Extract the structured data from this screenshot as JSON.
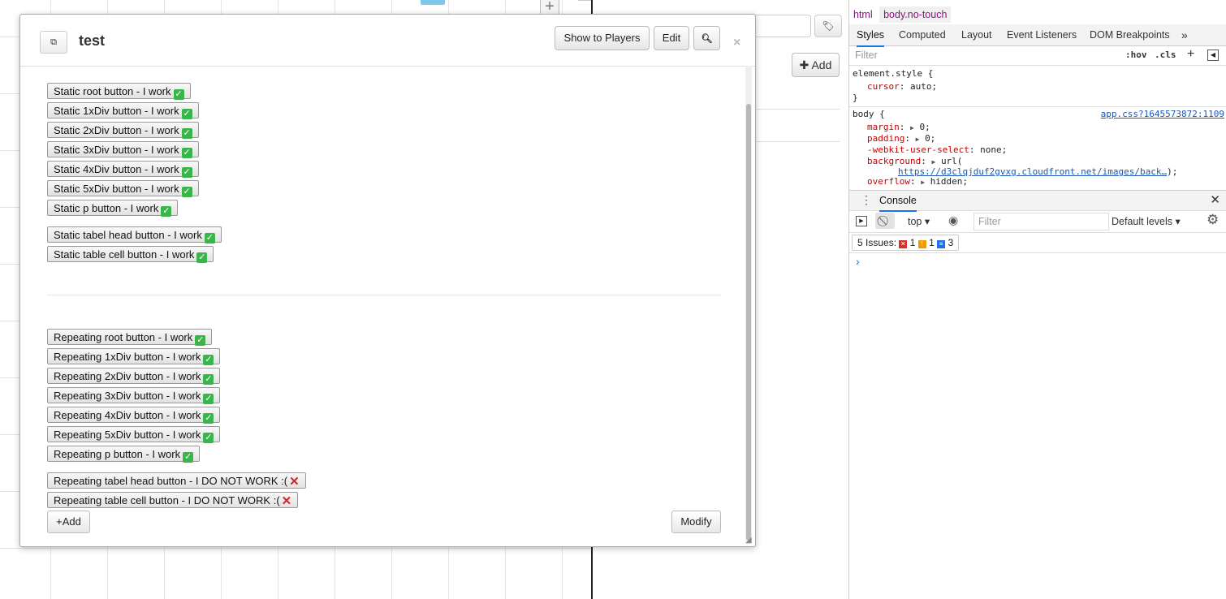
{
  "dialog": {
    "title": "test",
    "show_to_players": "Show to Players",
    "edit": "Edit",
    "close": "×",
    "static_buttons": [
      {
        "label": "Static root button - I work",
        "ok": true
      },
      {
        "label": "Static 1xDiv button - I work",
        "ok": true
      },
      {
        "label": "Static 2xDiv button - I work",
        "ok": true
      },
      {
        "label": "Static 3xDiv button - I work",
        "ok": true
      },
      {
        "label": "Static 4xDiv button - I work",
        "ok": true
      },
      {
        "label": "Static 5xDiv button - I work",
        "ok": true
      },
      {
        "label": "Static p button - I work",
        "ok": true
      },
      {
        "label": "Static tabel head button - I work",
        "ok": true
      },
      {
        "label": "Static table cell button - I work",
        "ok": true
      }
    ],
    "repeating_buttons": [
      {
        "label": "Repeating root button - I work",
        "ok": true
      },
      {
        "label": "Repeating 1xDiv button - I work",
        "ok": true
      },
      {
        "label": "Repeating 2xDiv button - I work",
        "ok": true
      },
      {
        "label": "Repeating 3xDiv button - I work",
        "ok": true
      },
      {
        "label": "Repeating 4xDiv button - I work",
        "ok": true
      },
      {
        "label": "Repeating 5xDiv button - I work",
        "ok": true
      },
      {
        "label": "Repeating p button - I work",
        "ok": true
      },
      {
        "label": "Repeating tabel head button - I DO NOT WORK :(",
        "ok": false
      },
      {
        "label": "Repeating table cell button - I DO NOT WORK :(",
        "ok": false
      }
    ],
    "add_label": "+Add",
    "modify_label": "Modify"
  },
  "mid_panel": {
    "add_label": "Add"
  },
  "devtools": {
    "breadcrumbs": [
      "html",
      "body.no-touch"
    ],
    "tabs": [
      "Styles",
      "Computed",
      "Layout",
      "Event Listeners",
      "DOM Breakpoints"
    ],
    "filter_placeholder": "Filter",
    "hov": ":hov",
    "cls": ".cls",
    "element_style": {
      "selector": "element.style {",
      "prop": "cursor",
      "value": "auto;",
      "close": "}"
    },
    "body_rule": {
      "selector": "body {",
      "source": "app.css?1645573872:1109",
      "props": [
        {
          "prop": "margin",
          "value": "0;"
        },
        {
          "prop": "padding",
          "value": "0;"
        },
        {
          "prop": "-webkit-user-select",
          "value": "none;"
        },
        {
          "prop": "background",
          "value": "url("
        },
        {
          "prop": "overflow",
          "value": "hidden;"
        }
      ],
      "bg_url": "https://d3clqjduf2gvxg.cloudfront.net/images/back…",
      "bg_url_end": ");"
    },
    "console_tab": "Console",
    "context": "top",
    "console_filter": "Filter",
    "levels": "Default levels",
    "issues_label": "5 Issues:",
    "issue_errors": "1",
    "issue_warnings": "1",
    "issue_info": "3"
  },
  "colors": {
    "ok_green": "#3ab54a",
    "bad_red": "#e0201c",
    "accent_blue": "#1a73e8"
  }
}
